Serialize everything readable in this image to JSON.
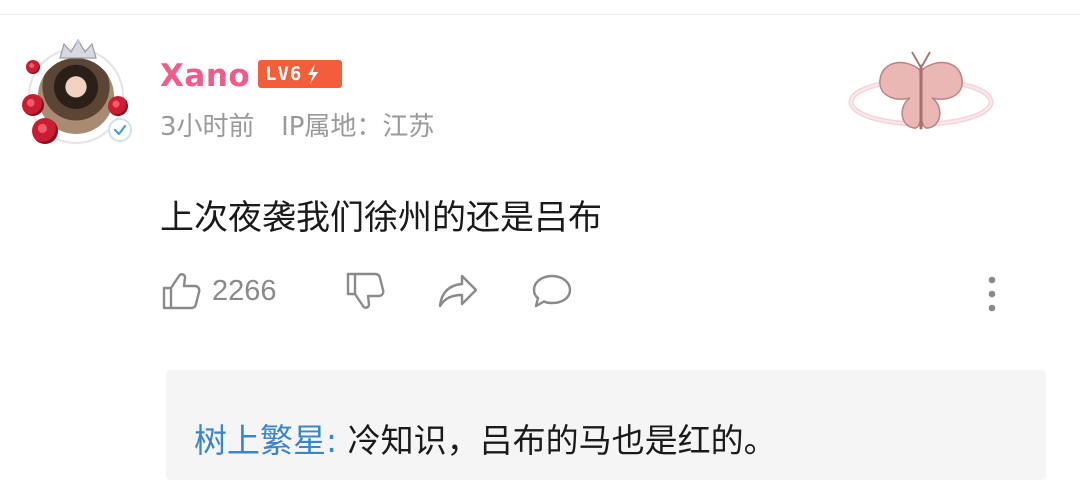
{
  "comment": {
    "username": "Xano",
    "level": "LV6",
    "time": "3小时前",
    "ip_location": "IP属地：江苏",
    "content": "上次夜袭我们徐州的还是吕布",
    "like_count": "2266"
  },
  "reply": {
    "user": "树上繁星",
    "separator": ": ",
    "text": "冷知识，吕布的马也是红的。"
  },
  "colors": {
    "username": "#ee5c8a",
    "level_badge": "#f25d3a",
    "reply_user": "#3a86c8",
    "meta_text": "#9a9a9a"
  }
}
